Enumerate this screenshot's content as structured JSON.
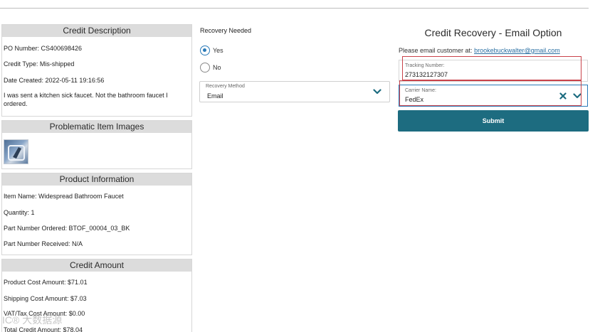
{
  "credit_description": {
    "header": "Credit Description",
    "po_number": "PO Number: CS400698426",
    "credit_type": "Credit Type: Mis-shipped",
    "date_created": "Date Created: 2022-05-11 19:16:56",
    "note": "I was sent a kitchen sick faucet. Not the bathroom faucet I ordered."
  },
  "problematic_images": {
    "header": "Problematic Item Images"
  },
  "product_information": {
    "header": "Product Information",
    "item_name": "Item Name: Widespread Bathroom Faucet",
    "quantity": "Quantity: 1",
    "part_ordered": "Part Number Ordered: BTOF_00004_03_BK",
    "part_received": "Part Number Received: N/A"
  },
  "credit_amount": {
    "header": "Credit Amount",
    "product_cost": "Product Cost Amount: $71.01",
    "shipping_cost": "Shipping Cost Amount: $7.03",
    "vat_tax": "VAT/Tax Cost Amount: $0.00",
    "total": "Total Credit Amount: $78.04"
  },
  "recovery": {
    "title": "Recovery Needed",
    "options": [
      "Yes",
      "No"
    ],
    "selected": "Yes",
    "method_caption": "Recovery Method",
    "method_value": "Email"
  },
  "credit_recovery": {
    "title": "Credit Recovery - Email Option",
    "email_prefix": "Please email customer at:",
    "email": "brookebuckwalter@gmail.com",
    "tracking_caption": "Tracking Number:",
    "tracking_value": "273132127307",
    "carrier_caption": "Carrier Name:",
    "carrier_value": "FedEx",
    "submit_label": "Submit"
  },
  "watermark": "IC® 大数据源",
  "colors": {
    "accent": "#2a7ab8",
    "submit_bg": "#1d6c80",
    "panel_header_bg": "#dcdcdc",
    "highlight_box": "#c9424a"
  }
}
